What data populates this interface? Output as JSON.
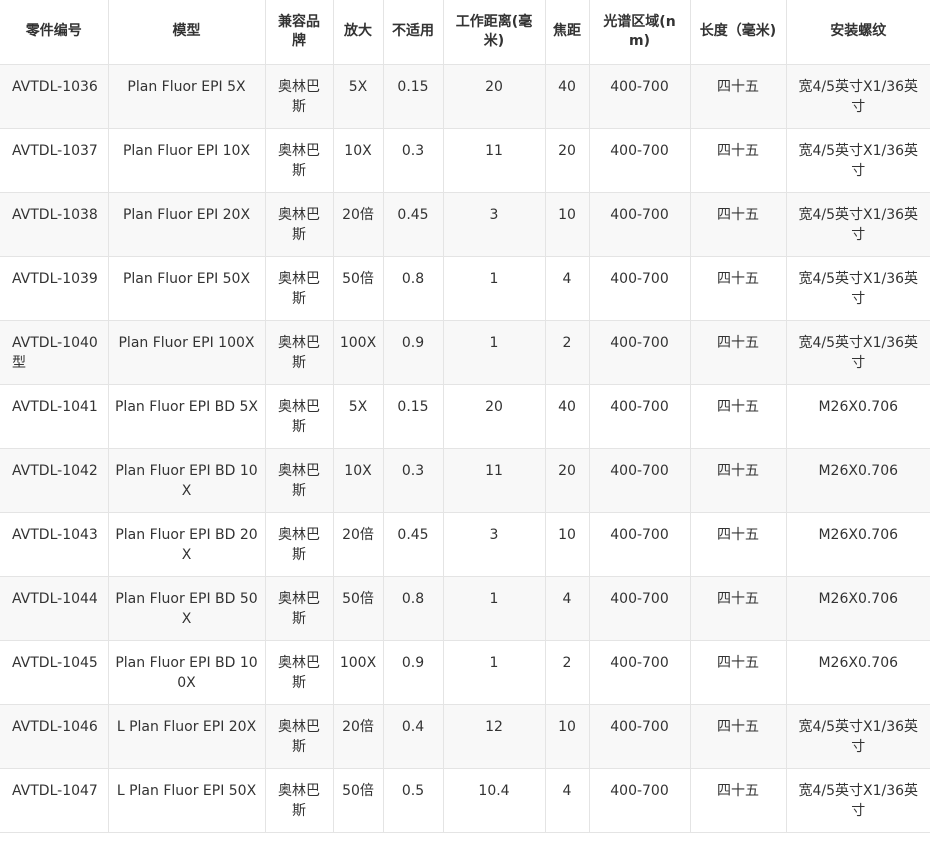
{
  "table": {
    "headers": [
      "零件编号",
      "模型",
      "兼容品牌",
      "放大",
      "不适用",
      "工作距离(毫米)",
      "焦距",
      "光谱区域(nm)",
      "长度（毫米)",
      "安装螺纹"
    ],
    "rows": [
      [
        "AVTDL-1036",
        "Plan Fluor EPI 5X",
        "奥林巴斯",
        "5X",
        "0.15",
        "20",
        "40",
        "400-700",
        "四十五",
        "宽4/5英寸X1/36英寸"
      ],
      [
        "AVTDL-1037",
        "Plan Fluor EPI 10X",
        "奥林巴斯",
        "10X",
        "0.3",
        "11",
        "20",
        "400-700",
        "四十五",
        "宽4/5英寸X1/36英寸"
      ],
      [
        "AVTDL-1038",
        "Plan Fluor EPI 20X",
        "奥林巴斯",
        "20倍",
        "0.45",
        "3",
        "10",
        "400-700",
        "四十五",
        "宽4/5英寸X1/36英寸"
      ],
      [
        "AVTDL-1039",
        "Plan Fluor EPI 50X",
        "奥林巴斯",
        "50倍",
        "0.8",
        "1",
        "4",
        "400-700",
        "四十五",
        "宽4/5英寸X1/36英寸"
      ],
      [
        "AVTDL-1040型",
        "Plan Fluor EPI 100X",
        "奥林巴斯",
        "100X",
        "0.9",
        "1",
        "2",
        "400-700",
        "四十五",
        "宽4/5英寸X1/36英寸"
      ],
      [
        "AVTDL-1041",
        "Plan Fluor EPI BD 5X",
        "奥林巴斯",
        "5X",
        "0.15",
        "20",
        "40",
        "400-700",
        "四十五",
        "M26X0.706"
      ],
      [
        "AVTDL-1042",
        "Plan Fluor EPI BD 10X",
        "奥林巴斯",
        "10X",
        "0.3",
        "11",
        "20",
        "400-700",
        "四十五",
        "M26X0.706"
      ],
      [
        "AVTDL-1043",
        "Plan Fluor EPI BD 20X",
        "奥林巴斯",
        "20倍",
        "0.45",
        "3",
        "10",
        "400-700",
        "四十五",
        "M26X0.706"
      ],
      [
        "AVTDL-1044",
        "Plan Fluor EPI BD 50X",
        "奥林巴斯",
        "50倍",
        "0.8",
        "1",
        "4",
        "400-700",
        "四十五",
        "M26X0.706"
      ],
      [
        "AVTDL-1045",
        "Plan Fluor EPI BD 100X",
        "奥林巴斯",
        "100X",
        "0.9",
        "1",
        "2",
        "400-700",
        "四十五",
        "M26X0.706"
      ],
      [
        "AVTDL-1046",
        "L Plan Fluor EPI 20X",
        "奥林巴斯",
        "20倍",
        "0.4",
        "12",
        "10",
        "400-700",
        "四十五",
        "宽4/5英寸X1/36英寸"
      ],
      [
        "AVTDL-1047",
        "L Plan Fluor EPI 50X",
        "奥林巴斯",
        "50倍",
        "0.5",
        "10.4",
        "4",
        "400-700",
        "四十五",
        "宽4/5英寸X1/36英寸"
      ]
    ]
  }
}
